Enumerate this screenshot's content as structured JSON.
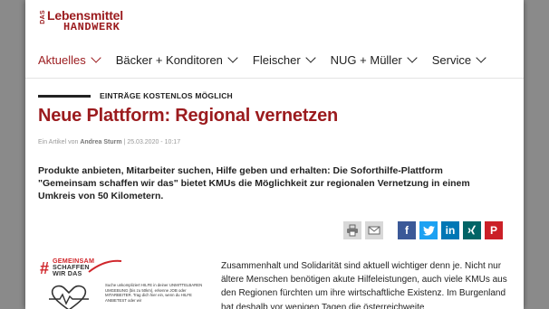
{
  "logo": {
    "das": "DAS",
    "line1": "Lebensmittel",
    "line2": "HANDWERK"
  },
  "nav": {
    "items": [
      {
        "label": "Aktuelles",
        "active": true
      },
      {
        "label": "Bäcker + Konditoren",
        "active": false
      },
      {
        "label": "Fleischer",
        "active": false
      },
      {
        "label": "NUG + Müller",
        "active": false
      },
      {
        "label": "Service",
        "active": false
      }
    ]
  },
  "article": {
    "kicker": "EINTRÄGE KOSTENLOS MÖGLICH",
    "title": "Neue Plattform: Regional vernetzen",
    "meta_prefix": "Ein Artikel von ",
    "author": "Andrea Sturm",
    "meta_date": " | 25.03.2020 - 10:17",
    "lead": "Produkte anbieten, Mitarbeiter suchen, Hilfe geben und erhalten: Die Soforthilfe-Plattform \"Gemeinsam schaffen wir das\" bietet KMUs die Möglichkeit zur regionalen Vernetzung in einem Umkreis von 50 Kilometern.",
    "body": "Zusammenhalt und Solidarität sind aktuell wichtiger denn je. Nicht nur ältere Menschen benötigen akute Hilfeleistungen, auch viele KMUs aus den Regionen fürchten um ihre wirtschaftliche Existenz. Im Burgenland hat deshalb vor wenigen Tagen die österreichweite"
  },
  "share": {
    "icons": [
      "print-icon",
      "mail-icon",
      "facebook-icon",
      "twitter-icon",
      "linkedin-icon",
      "xing-icon",
      "pinterest-icon"
    ],
    "labels": {
      "print": "",
      "mail": "",
      "facebook": "f",
      "twitter": "",
      "linkedin": "in",
      "xing": "",
      "pinterest": "P"
    },
    "colors": {
      "facebook": "#3b5998",
      "twitter": "#1da1f2",
      "linkedin": "#0077b5",
      "xing": "#026466",
      "pinterest": "#cb2027"
    }
  },
  "promo": {
    "hash": "#",
    "line1": "GEMEINSAM",
    "line2": "SCHAFFEN",
    "line3": "WIR DAS",
    "tiny": "Suche unkompliziert HILFE in deiner UNMITTELBAREN UMGEBUNG (bis zu 50km), erkenne JOB oder MITARBEITER. Trag dich hier ein, wenn du HILFE ANBIETEST oder wir"
  },
  "colors": {
    "brand": "#9b1b1e",
    "promo_red": "#d0262b"
  }
}
